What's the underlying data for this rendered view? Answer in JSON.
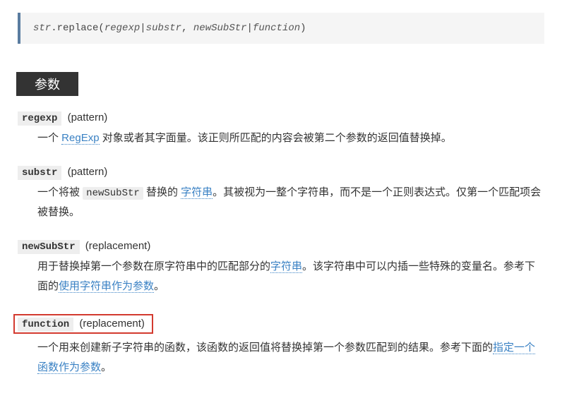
{
  "syntax": {
    "prefix": "str",
    "method": ".replace(",
    "arg1a": "regexp",
    "sep1": "|",
    "arg1b": "substr",
    "comma": ", ",
    "arg2a": "newSubStr",
    "sep2": "|",
    "arg2b": "function",
    "close": ")"
  },
  "section_title": "参数",
  "params": {
    "regexp": {
      "name": "regexp",
      "role": "(pattern)",
      "desc_a": "一个 ",
      "link1": "RegExp",
      "desc_b": " 对象或者其字面量。该正则所匹配的内容会被第二个参数的返回值替换掉。"
    },
    "substr": {
      "name": "substr",
      "role": "(pattern)",
      "desc_a": "一个将被 ",
      "code1": "newSubStr",
      "desc_b": " 替换的 ",
      "link1": "字符串",
      "desc_c": "。其被视为一整个字符串，而不是一个正则表达式。仅第一个匹配项会被替换。"
    },
    "newSubStr": {
      "name": "newSubStr",
      "role": "(replacement)",
      "desc_a": "用于替换掉第一个参数在原字符串中的匹配部分的",
      "link1": "字符串",
      "desc_b": "。该字符串中可以内插一些特殊的变量名。参考下面的",
      "link2": "使用字符串作为参数",
      "desc_c": "。"
    },
    "function": {
      "name": "function",
      "role": "(replacement)",
      "desc_a": "一个用来创建新子字符串的函数，该函数的返回值将替换掉第一个参数匹配到的结果。参考下面的",
      "link1": "指定一个函数作为参数",
      "desc_b": "。"
    }
  }
}
